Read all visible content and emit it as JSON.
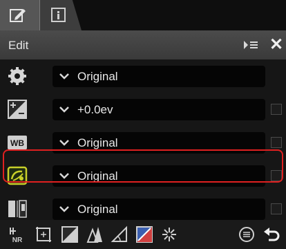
{
  "header": {
    "title": "Edit"
  },
  "rows": [
    {
      "icon": "gear-icon",
      "value": "Original",
      "checkbox": false
    },
    {
      "icon": "exposure-compensation-icon",
      "value": "+0.0ev",
      "checkbox": true
    },
    {
      "icon": "white-balance-icon",
      "value": "Original",
      "checkbox": true
    },
    {
      "icon": "picture-control-icon",
      "value": "Original",
      "checkbox": true,
      "highlighted": true
    },
    {
      "icon": "tone-adjust-icon",
      "value": "Original",
      "checkbox": true
    }
  ],
  "toolbar": {
    "icons": [
      "noise-reduction-icon",
      "crop-icon",
      "tone-curve-icon",
      "perspective-icon",
      "straighten-icon",
      "color-booster-icon",
      "retouch-brush-icon",
      "adjustment-list-icon",
      "undo-icon"
    ]
  },
  "colors": {
    "highlight": "#e02020",
    "wb_badge": "#cfcfcf",
    "picture_control": "#c8cf2a"
  }
}
